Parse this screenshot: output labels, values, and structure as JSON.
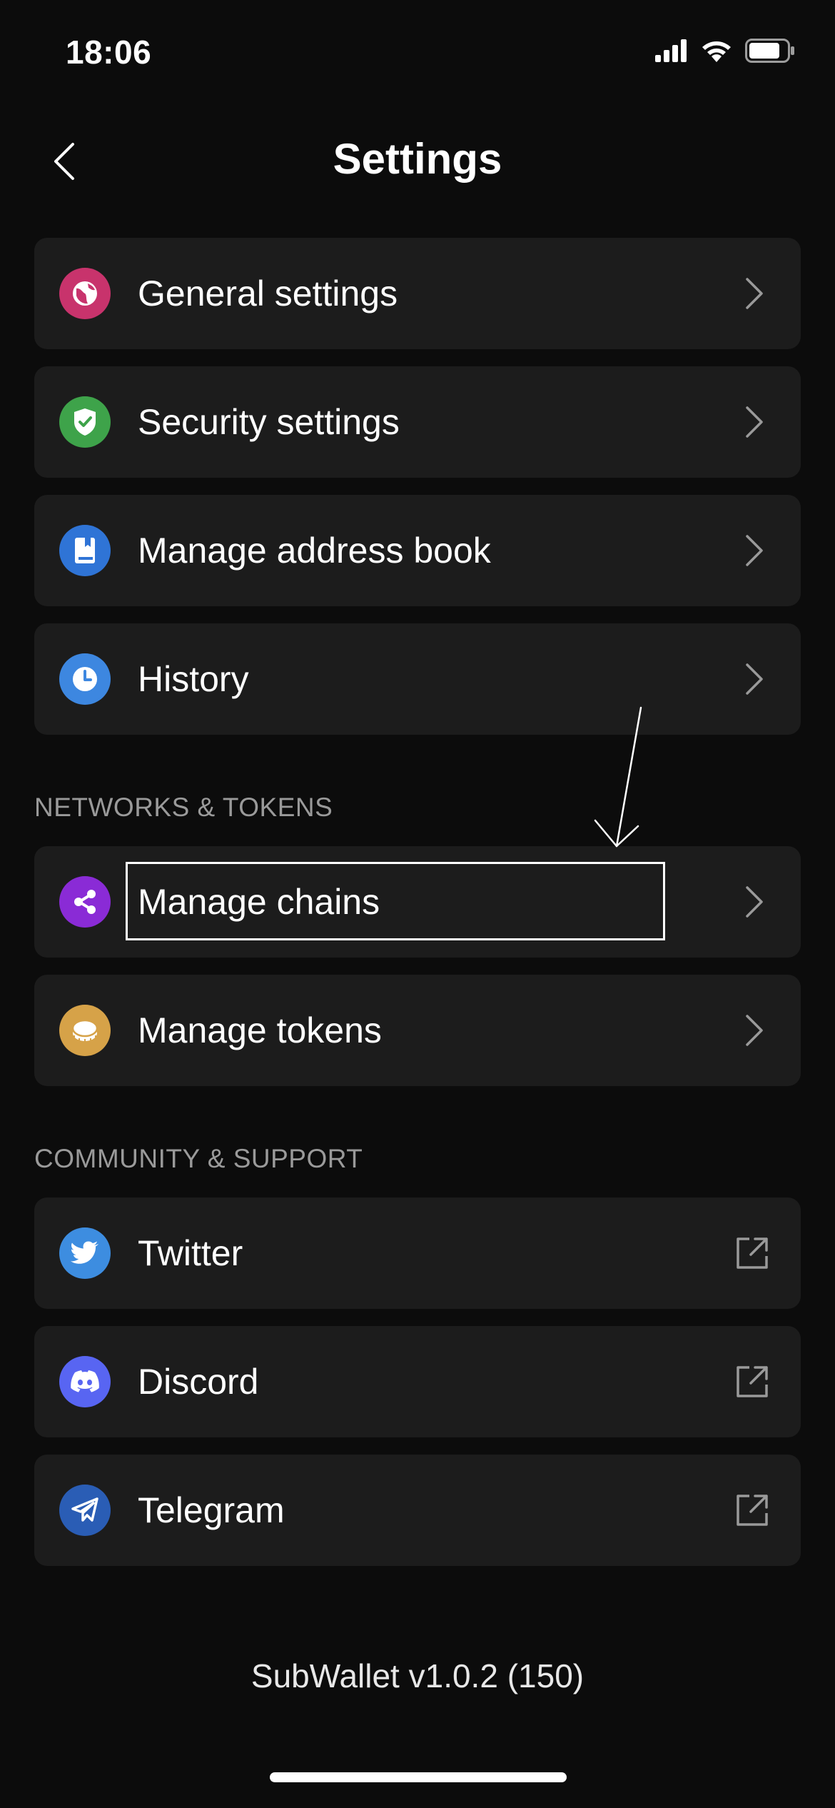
{
  "status_bar": {
    "time": "18:06"
  },
  "header": {
    "title": "Settings"
  },
  "main_items": [
    {
      "label": "General settings",
      "icon": "globe-icon",
      "color": "#c8336c"
    },
    {
      "label": "Security settings",
      "icon": "shield-check-icon",
      "color": "#3ea34a"
    },
    {
      "label": "Manage address book",
      "icon": "book-icon",
      "color": "#2f74d6"
    },
    {
      "label": "History",
      "icon": "clock-icon",
      "color": "#3d87e0"
    }
  ],
  "networks_section": {
    "title": "NETWORKS & TOKENS",
    "items": [
      {
        "label": "Manage chains",
        "icon": "share-icon",
        "color": "#8a2bd6"
      },
      {
        "label": "Manage tokens",
        "icon": "coin-icon",
        "color": "#d6a248"
      }
    ]
  },
  "community_section": {
    "title": "COMMUNITY & SUPPORT",
    "items": [
      {
        "label": "Twitter",
        "icon": "twitter-icon",
        "color": "#3d8de0"
      },
      {
        "label": "Discord",
        "icon": "discord-icon",
        "color": "#5865f2"
      },
      {
        "label": "Telegram",
        "icon": "telegram-icon",
        "color": "#2a5db5"
      }
    ]
  },
  "footer": {
    "version": "SubWallet v1.0.2 (150)"
  }
}
